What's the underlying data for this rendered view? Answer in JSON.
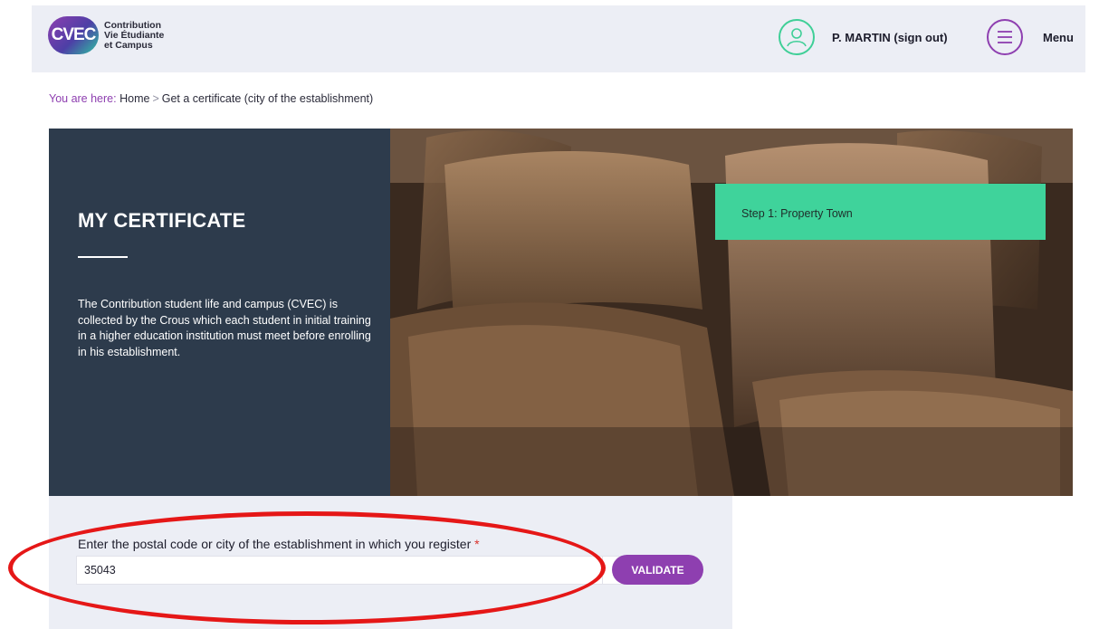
{
  "header": {
    "logo_badge": "CVEC",
    "logo_lines": [
      "Contribution",
      "Vie Étudiante",
      "et Campus"
    ],
    "user_label": "P. MARTIN (sign out)",
    "menu_label": "Menu"
  },
  "breadcrumb": {
    "prefix": "You are here:",
    "items": [
      "Home",
      "Get a certificate (city of the establishment)"
    ],
    "separator": ">"
  },
  "hero": {
    "title": "MY CERTIFICATE",
    "description": "The Contribution student life and campus (CVEC) is collected by the Crous which each student in initial training in a higher education institution must meet before enrolling in his establishment.",
    "step_label": "Step 1: Property Town"
  },
  "form": {
    "label": "Enter the postal code or city of the establishment in which you register",
    "required_mark": "*",
    "input_value": "35043",
    "clear_symbol": "×",
    "validate_label": "VALIDATE"
  },
  "colors": {
    "brand_purple": "#8e3fb0",
    "brand_green": "#3fd39b",
    "hero_dark": "#2d3b4c",
    "panel_bg": "#eceef5",
    "annotation_red": "#e51717"
  },
  "icons": {
    "user": "user-icon",
    "menu": "menu-icon",
    "clear": "close-icon"
  }
}
